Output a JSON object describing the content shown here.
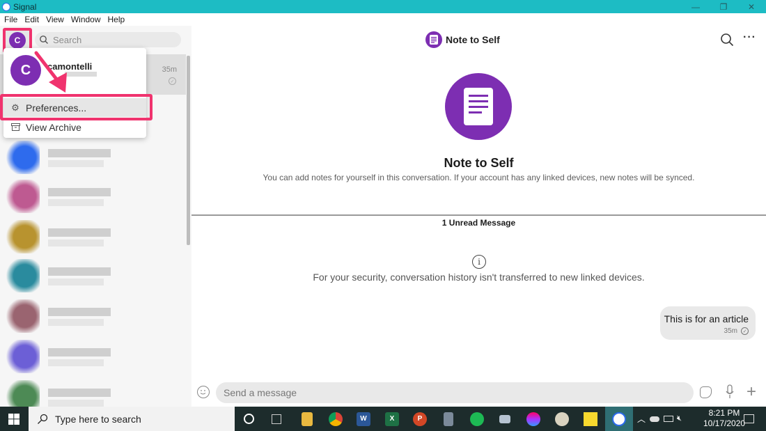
{
  "window": {
    "title": "Signal",
    "controls": {
      "minimize": "—",
      "maximize": "❐",
      "close": "✕"
    }
  },
  "menubar": [
    "File",
    "Edit",
    "View",
    "Window",
    "Help"
  ],
  "sidebar": {
    "avatar_initial": "C",
    "search_placeholder": "Search",
    "selected_conversation": {
      "time": "35m",
      "status": "sent"
    },
    "blurred_contacts": [
      {
        "color": "#2e6bed"
      },
      {
        "color": "#be5a91"
      },
      {
        "color": "#b8932f"
      },
      {
        "color": "#2a8b9e"
      },
      {
        "color": "#9a6470"
      },
      {
        "color": "#6c5fd6"
      },
      {
        "color": "#4d8a55"
      }
    ]
  },
  "profile_menu": {
    "avatar_initial": "C",
    "name": "camontelli",
    "items": [
      {
        "label": "Preferences...",
        "icon": "gear-icon"
      },
      {
        "label": "View Archive",
        "icon": "archive-icon"
      }
    ]
  },
  "conversation": {
    "header_title": "Note to Self",
    "hero_title": "Note to Self",
    "hero_subtitle": "You can add notes for yourself in this conversation. If your account has any linked devices, new notes will be synced.",
    "unread_label": "1 Unread Message",
    "security_notice": "For your security, conversation history isn't transferred to new linked devices.",
    "messages": [
      {
        "text": "This is for an article",
        "time": "35m",
        "status": "sent",
        "outgoing": true
      }
    ],
    "composer_placeholder": "Send a message"
  },
  "taskbar": {
    "search_placeholder": "Type here to search",
    "apps": [
      "cortana",
      "task-view",
      "file-explorer",
      "chrome",
      "word",
      "excel",
      "powerpoint",
      "calculator",
      "spotify",
      "app",
      "paint-3d",
      "paint",
      "sticky-notes",
      "signal"
    ],
    "time": "8:21 PM",
    "date": "10/17/2020"
  },
  "colors": {
    "titlebar": "#1dbcc4",
    "accent_purple": "#7d2eb2",
    "annotation_pink": "#f0336e",
    "taskbar": "#1d2c2c"
  }
}
